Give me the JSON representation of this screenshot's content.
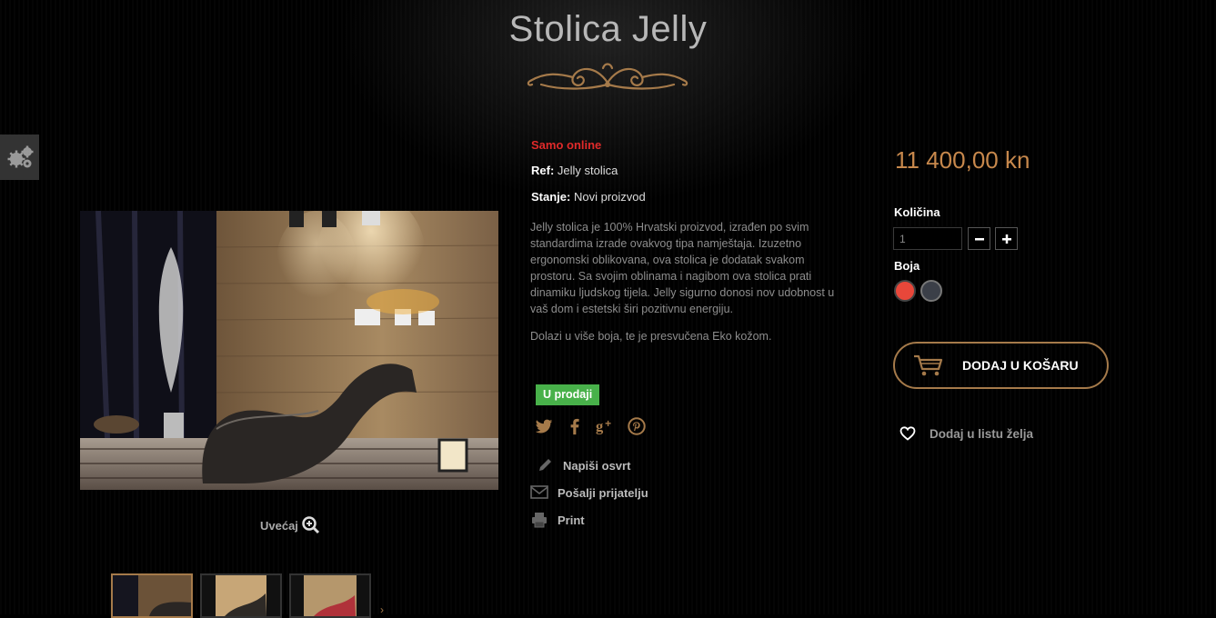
{
  "product": {
    "title": "Stolica Jelly",
    "online_only": "Samo online",
    "ref_label": "Ref:",
    "ref_value": "Jelly stolica",
    "condition_label": "Stanje:",
    "condition_value": "Novi proizvod",
    "description": [
      "Jelly stolica je 100% Hrvatski proizvod, izrađen po svim standardima izrade ovakvog tipa namještaja. Izuzetno ergonomski oblikovana, ova stolica je dodatak svakom prostoru. Sa svojim oblinama i nagibom ova stolica prati dinamiku ljudskog tijela. Jelly sigurno donosi nov udobnost u vaš dom i estetski širi pozitivnu energiju.",
      "Dolazi u više boja, te je presvučena Eko kožom."
    ],
    "stock_badge": "U prodaji",
    "price": "11 400,00 kn"
  },
  "gallery": {
    "zoom_label": "Uvećaj"
  },
  "actions": {
    "review": "Napiši osvrt",
    "send_friend": "Pošalji prijatelju",
    "print": "Print"
  },
  "purchase": {
    "quantity_label": "Količina",
    "quantity_value": "1",
    "color_label": "Boja",
    "colors": [
      "#e8473a",
      "#3b3f48"
    ],
    "add_to_cart": "DODAJ U KOŠARU",
    "wishlist": "Dodaj u listu želja"
  },
  "social_icons": [
    "twitter-icon",
    "facebook-icon",
    "google-plus-icon",
    "pinterest-icon"
  ],
  "accent_color": "#a57a4a"
}
